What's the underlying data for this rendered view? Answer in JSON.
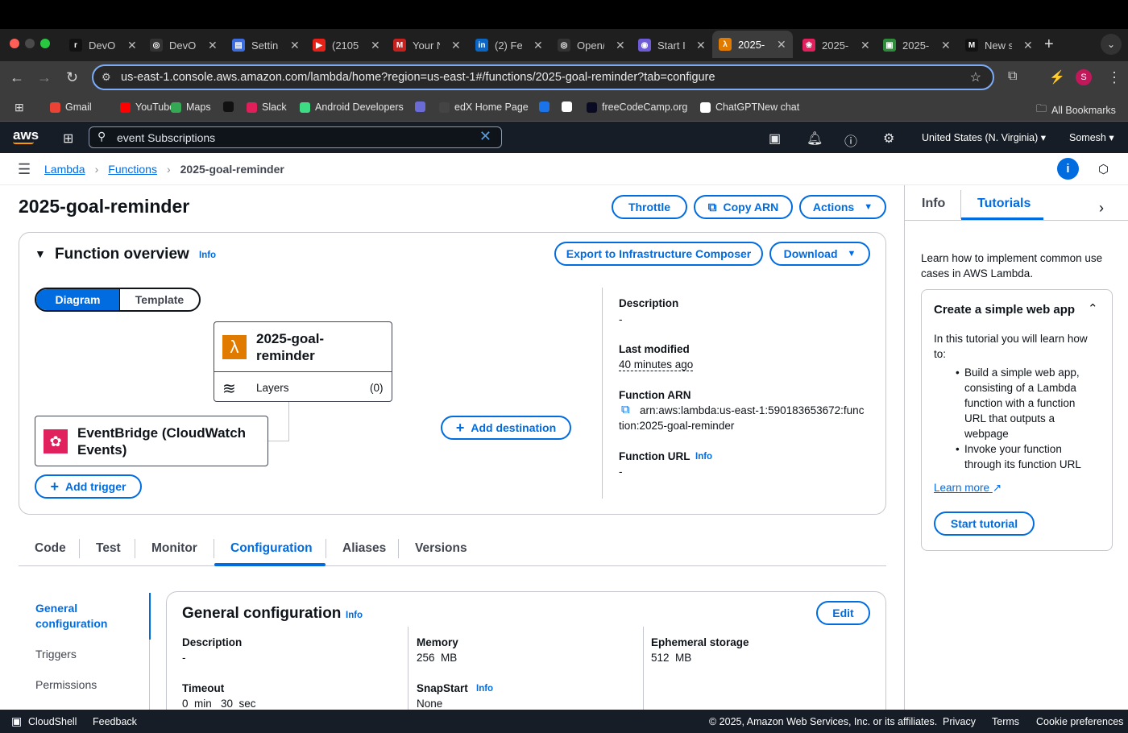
{
  "browser": {
    "tabs": [
      {
        "title": "DevOp",
        "color": "#111",
        "glyph": "r"
      },
      {
        "title": "DevOp",
        "color": "#333",
        "glyph": "◎"
      },
      {
        "title": "Settin",
        "color": "#3b6de0",
        "glyph": "▤"
      },
      {
        "title": "(2105",
        "color": "#e62117",
        "glyph": "▶"
      },
      {
        "title": "Your N",
        "color": "#c5221f",
        "glyph": "M"
      },
      {
        "title": "(2) Fe",
        "color": "#0a66c2",
        "glyph": "in"
      },
      {
        "title": "Open/",
        "color": "#333",
        "glyph": "◎"
      },
      {
        "title": "Start I",
        "color": "#6e5bd6",
        "glyph": "◉"
      },
      {
        "title": "2025-",
        "color": "#e07b00",
        "glyph": "λ"
      },
      {
        "title": "2025-",
        "color": "#e0215e",
        "glyph": "❀"
      },
      {
        "title": "2025-",
        "color": "#2e8b3a",
        "glyph": "▣"
      },
      {
        "title": "New s",
        "color": "#111",
        "glyph": "M"
      }
    ],
    "new_tab": "+",
    "url": "us-east-1.console.aws.amazon.com/lambda/home?region=us-east-1#/functions/2025-goal-reminder?tab=configure",
    "profile_initial": "S",
    "bookmarks": [
      {
        "label": "Gmail",
        "color": "#ea4335"
      },
      {
        "label": "YouTube",
        "color": "#ff0000"
      },
      {
        "label": "Maps",
        "color": "#34a853"
      },
      {
        "label": "",
        "color": "#111"
      },
      {
        "label": "Slack",
        "color": "#e01e5a"
      },
      {
        "label": "Android Developers",
        "color": "#3ddc84"
      },
      {
        "label": "",
        "color": "#6b6bd6"
      },
      {
        "label": "edX Home Page",
        "color": "#444"
      },
      {
        "label": "",
        "color": "#1a73e8"
      },
      {
        "label": "",
        "color": "#fff"
      },
      {
        "label": "freeCodeCamp.org",
        "color": "#0a0a23"
      },
      {
        "label": "ChatGPTNew chat",
        "color": "#fff"
      }
    ],
    "all_bookmarks": "All Bookmarks"
  },
  "aws": {
    "logo": "aws",
    "search_value": "event Subscriptions",
    "region": "United States (N. Virginia)",
    "user": "Somesh"
  },
  "breadcrumb": {
    "items": [
      "Lambda",
      "Functions"
    ],
    "current": "2025-goal-reminder"
  },
  "page": {
    "title": "2025-goal-reminder",
    "throttle": "Throttle",
    "copy_arn": "Copy ARN",
    "actions": "Actions"
  },
  "overview": {
    "title": "Function overview",
    "info": "Info",
    "export": "Export to Infrastructure Composer",
    "download": "Download",
    "seg_diagram": "Diagram",
    "seg_template": "Template",
    "func_name_1": "2025-goal-",
    "func_name_2": "reminder",
    "layers": "Layers",
    "layers_count": "(0)",
    "trigger_1": "EventBridge (CloudWatch",
    "trigger_2": "Events)",
    "add_destination": "Add destination",
    "add_trigger": "Add trigger",
    "desc_label": "Description",
    "desc_value": "-",
    "modified_label": "Last modified",
    "modified_value": "40 minutes ago",
    "arn_label": "Function ARN",
    "arn_1": "arn:aws:lambda:us-east-1:590183653672:func",
    "arn_2": "tion:2025-goal-reminder",
    "url_label": "Function URL",
    "url_info": "Info",
    "url_value": "-"
  },
  "tabs": [
    "Code",
    "Test",
    "Monitor",
    "Configuration",
    "Aliases",
    "Versions"
  ],
  "config_nav": {
    "general_1": "General",
    "general_2": "configuration",
    "triggers": "Triggers",
    "permissions": "Permissions"
  },
  "general": {
    "title": "General configuration",
    "info": "Info",
    "edit": "Edit",
    "desc_label": "Description",
    "desc_value": "-",
    "memory_label": "Memory",
    "memory_value": "256  MB",
    "eph_label": "Ephemeral storage",
    "eph_value": "512  MB",
    "timeout_label": "Timeout",
    "timeout_value": "0  min   30  sec",
    "snap_label": "SnapStart",
    "snap_info": "Info",
    "snap_value": "None"
  },
  "panel": {
    "tab_info": "Info",
    "tab_tutorials": "Tutorials",
    "intro_1": "Learn how to implement common use",
    "intro_2": "cases in AWS Lambda.",
    "card_title": "Create a simple web app",
    "card_text_1": "In this tutorial you will learn how",
    "card_text_2": "to:",
    "bullet1": [
      "Build a simple web app,",
      "consisting of a Lambda",
      "function with a function",
      "URL that outputs a",
      "webpage"
    ],
    "bullet2": [
      "Invoke your function",
      "through its function URL"
    ],
    "learn_more": "Learn more",
    "start": "Start tutorial"
  },
  "footer": {
    "cloudshell": "CloudShell",
    "feedback": "Feedback",
    "copyright": "© 2025, Amazon Web Services, Inc. or its affiliates.",
    "privacy": "Privacy",
    "terms": "Terms",
    "cookies": "Cookie preferences"
  }
}
